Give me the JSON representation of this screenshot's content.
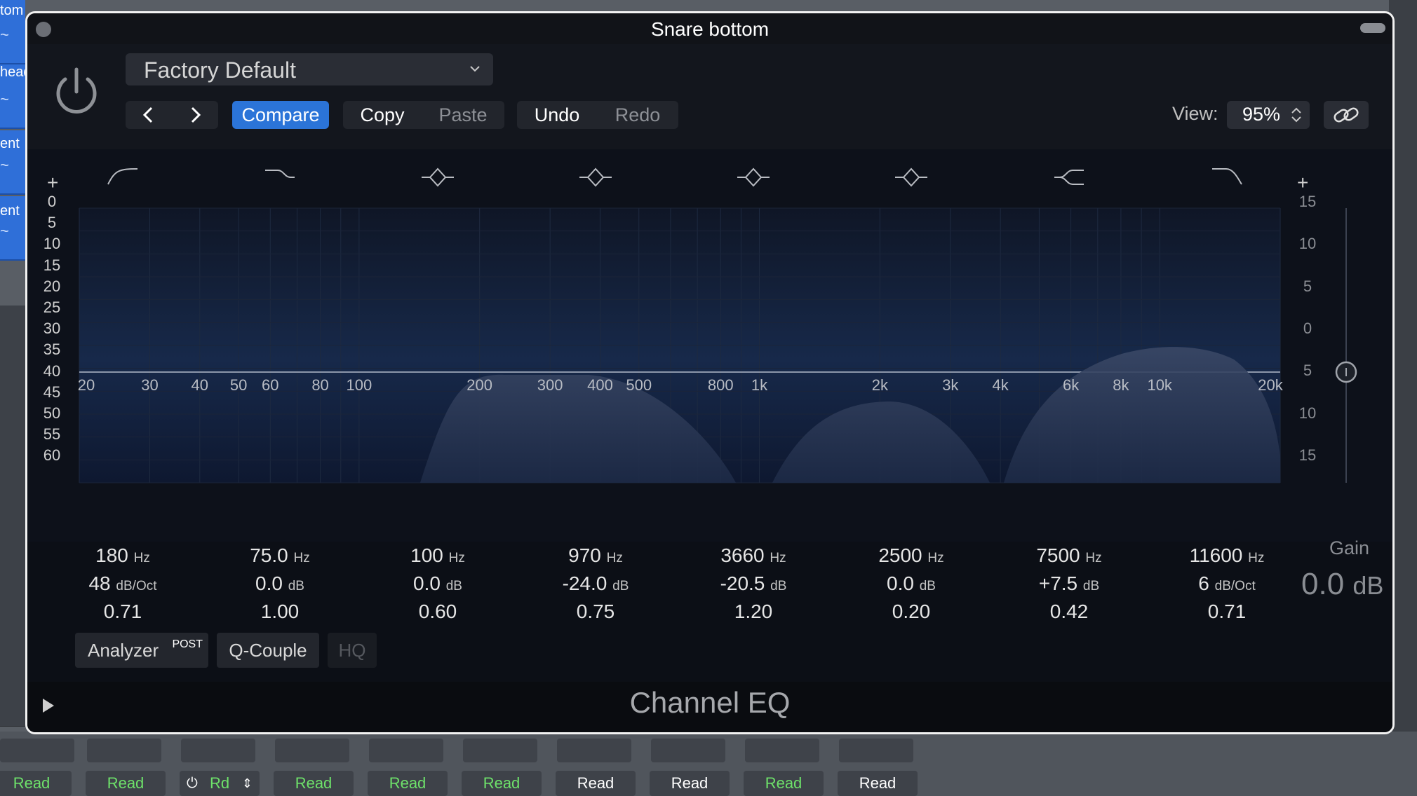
{
  "window": {
    "title": "Snare bottom"
  },
  "preset": {
    "name": "Factory Default"
  },
  "toolbar": {
    "compare": "Compare",
    "copy": "Copy",
    "paste": "Paste",
    "undo": "Undo",
    "redo": "Redo",
    "view_label": "View:",
    "view_value": "95%"
  },
  "graph": {
    "left_scale": [
      "0",
      "5",
      "10",
      "15",
      "20",
      "25",
      "30",
      "35",
      "40",
      "45",
      "50",
      "55",
      "60"
    ],
    "right_scale": [
      "15",
      "10",
      "5",
      "0",
      "5",
      "10",
      "15"
    ],
    "freq_ticks": [
      "20",
      "30",
      "40",
      "50",
      "60",
      "80",
      "100",
      "200",
      "300",
      "400",
      "500",
      "800",
      "1k",
      "2k",
      "3k",
      "4k",
      "6k",
      "8k",
      "10k",
      "20k"
    ]
  },
  "bands": [
    {
      "freq": "180",
      "freq_unit": "Hz",
      "gain": "48",
      "gain_unit": "dB/Oct",
      "q": "0.71",
      "type": "highpass-icon"
    },
    {
      "freq": "75.0",
      "freq_unit": "Hz",
      "gain": "0.0",
      "gain_unit": "dB",
      "q": "1.00",
      "type": "lowshelf-icon"
    },
    {
      "freq": "100",
      "freq_unit": "Hz",
      "gain": "0.0",
      "gain_unit": "dB",
      "q": "0.60",
      "type": "bell-icon"
    },
    {
      "freq": "970",
      "freq_unit": "Hz",
      "gain": "-24.0",
      "gain_unit": "dB",
      "q": "0.75",
      "type": "bell-icon"
    },
    {
      "freq": "3660",
      "freq_unit": "Hz",
      "gain": "-20.5",
      "gain_unit": "dB",
      "q": "1.20",
      "type": "bell-icon"
    },
    {
      "freq": "2500",
      "freq_unit": "Hz",
      "gain": "0.0",
      "gain_unit": "dB",
      "q": "0.20",
      "type": "bell-icon"
    },
    {
      "freq": "7500",
      "freq_unit": "Hz",
      "gain": "+7.5",
      "gain_unit": "dB",
      "q": "0.42",
      "type": "highshelf-icon"
    },
    {
      "freq": "11600",
      "freq_unit": "Hz",
      "gain": "6",
      "gain_unit": "dB/Oct",
      "q": "0.71",
      "type": "lowpass-icon"
    }
  ],
  "gain": {
    "label": "Gain",
    "value": "0.0",
    "unit": "dB"
  },
  "options": {
    "analyzer": "Analyzer",
    "analyzer_tag": "POST",
    "qcouple": "Q-Couple",
    "hq": "HQ"
  },
  "footer": {
    "plugin_name": "Channel EQ"
  },
  "background": {
    "tracks": [
      "tom",
      "head",
      "ent",
      "ent"
    ],
    "automation": [
      "Read",
      "Read",
      "Rd",
      "Read",
      "Read",
      "Read",
      "Read",
      "Read",
      "Read",
      "Read"
    ],
    "colors": {
      "accent": "#2b74d8",
      "read_green": "#6ee26a",
      "track_blue": "#2f6fd8"
    }
  }
}
